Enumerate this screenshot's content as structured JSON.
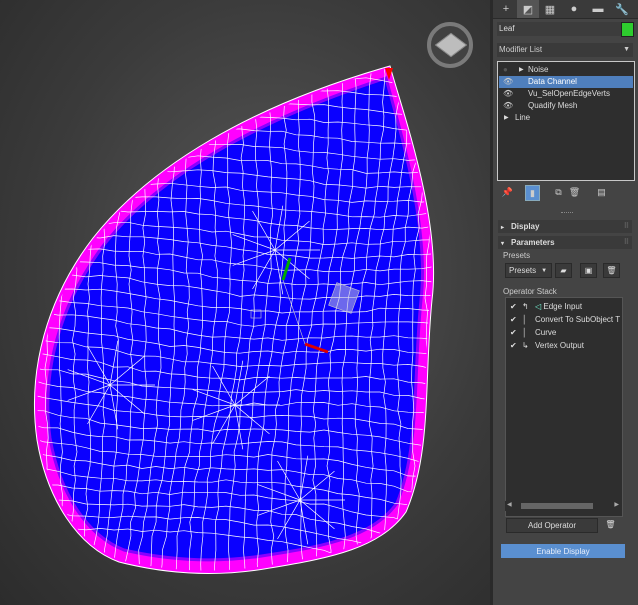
{
  "tabs": [
    {
      "icon": "plus-icon"
    },
    {
      "icon": "modify-icon"
    },
    {
      "icon": "hierarchy-icon"
    },
    {
      "icon": "motion-icon"
    },
    {
      "icon": "display-icon"
    },
    {
      "icon": "utilities-icon"
    }
  ],
  "object": {
    "name": "Leaf",
    "color": "#2ecc2e"
  },
  "modifier_list": {
    "label": "Modifier List"
  },
  "stack": [
    {
      "label": "Noise",
      "visible": false,
      "expandable": true,
      "selected": false
    },
    {
      "label": "Data Channel",
      "visible": true,
      "expandable": false,
      "selected": true
    },
    {
      "label": "Vu_SelOpenEdgeVerts",
      "visible": true,
      "expandable": false,
      "selected": false
    },
    {
      "label": "Quadify Mesh",
      "visible": true,
      "expandable": false,
      "selected": false
    },
    {
      "label": "Line",
      "visible": false,
      "expandable": true,
      "selected": false
    }
  ],
  "rollouts": {
    "display": "Display",
    "parameters": "Parameters"
  },
  "presets": {
    "section_label": "Presets",
    "dropdown": "Presets"
  },
  "operator_stack": {
    "label": "Operator Stack",
    "items": [
      {
        "label": "Edge Input",
        "checked": true
      },
      {
        "label": "Convert To SubObject T",
        "checked": true
      },
      {
        "label": "Curve",
        "checked": true
      },
      {
        "label": "Vertex Output",
        "checked": true
      }
    ],
    "add_label": "Add Operator"
  },
  "enable_display": "Enable Display",
  "colors": {
    "mesh_fill": "#0000ff",
    "mesh_border": "#ff00ff",
    "wire": "#ffffff",
    "accent": "#5a8fd0"
  }
}
